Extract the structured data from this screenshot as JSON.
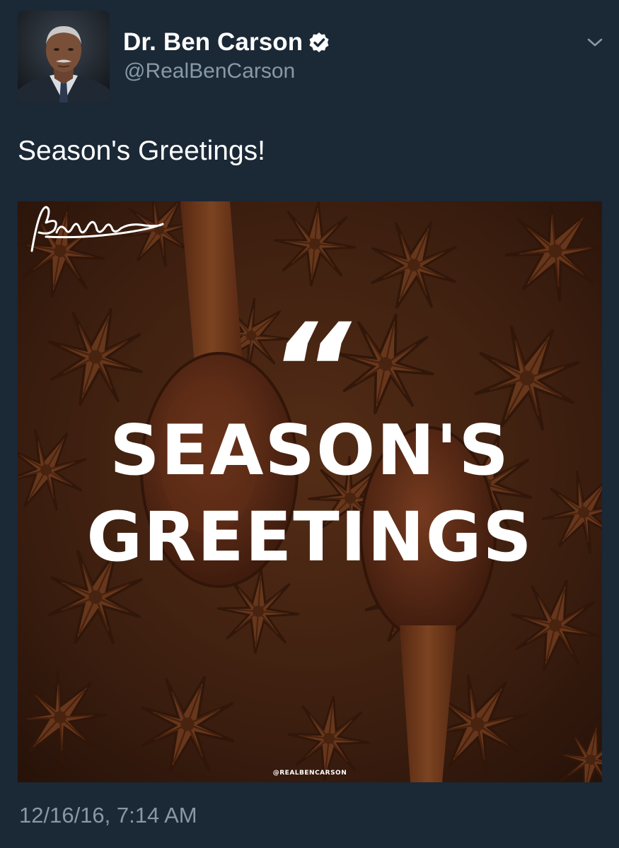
{
  "author": {
    "display_name": "Dr. Ben Carson",
    "handle": "@RealBenCarson",
    "verified": true,
    "avatar_icon": "profile-photo"
  },
  "tweet": {
    "text": "Season's Greetings!",
    "timestamp": "12/16/16, 7:14 AM"
  },
  "media": {
    "quote_glyph": "“",
    "headline_line1": "SEASON'S",
    "headline_line2": "GREETINGS",
    "signature_text": "Ben Carson",
    "watermark": "@REALBENCARSON"
  },
  "icons": {
    "verified": "verified-badge-icon",
    "caret": "chevron-down-icon"
  },
  "colors": {
    "background": "#1b2836",
    "secondary_text": "#8899a6",
    "primary_text": "#ffffff"
  }
}
